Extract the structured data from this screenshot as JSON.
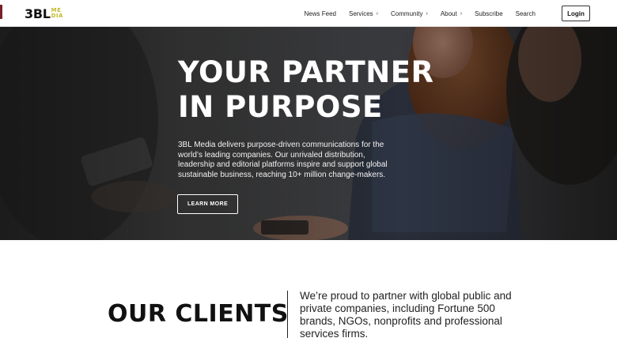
{
  "header": {
    "logo": {
      "main": "3BL",
      "sub_top": "ME",
      "sub_bottom": "DIA"
    },
    "nav": [
      {
        "label": "News Feed",
        "has_chevron": false
      },
      {
        "label": "Services",
        "has_chevron": true
      },
      {
        "label": "Community",
        "has_chevron": true
      },
      {
        "label": "About",
        "has_chevron": true
      },
      {
        "label": "Subscribe",
        "has_chevron": false
      },
      {
        "label": "Search",
        "has_chevron": false
      }
    ],
    "chevron_glyph": "›",
    "login_label": "Login"
  },
  "hero": {
    "title_line1": "YOUR PARTNER",
    "title_line2": "IN PURPOSE",
    "description": "3BL Media delivers purpose-driven communications for the world’s leading companies. Our unrivaled distribution, leadership and editorial platforms inspire and support global sustainable business, reaching 10+ million change-makers.",
    "button_label": "LEARN MORE"
  },
  "clients": {
    "title": "OUR CLIENTS",
    "text": "We’re proud to partner with global public and private companies, including Fortune 500 brands, NGOs, nonprofits and professional services firms."
  },
  "colors": {
    "logo_accent": "#c4b92a",
    "edge_mark": "#7a1f2b"
  }
}
